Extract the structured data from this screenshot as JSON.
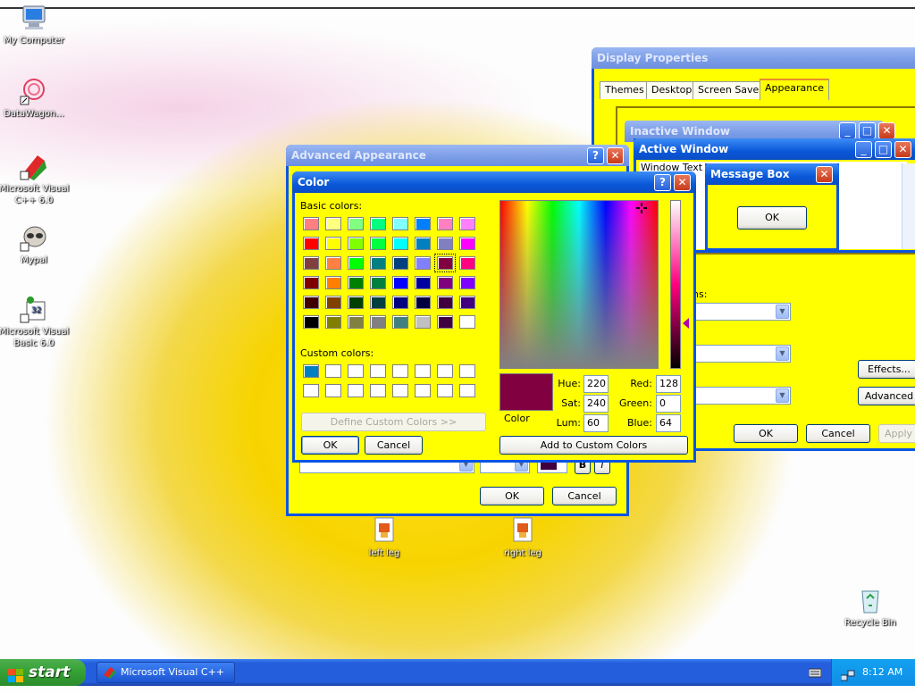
{
  "desktop_icons": [
    {
      "label": "My Computer",
      "icon": "computer-icon"
    },
    {
      "label": "DataWagon...",
      "icon": "datawagon-icon"
    },
    {
      "label": "Microsoft Visual C++ 6.0",
      "icon": "visual-cpp-icon"
    },
    {
      "label": "Mypal",
      "icon": "mypal-icon"
    },
    {
      "label": "Microsoft Visual Basic 6.0",
      "icon": "visual-basic-icon"
    },
    {
      "label": "left leg",
      "icon": "file-icon"
    },
    {
      "label": "right leg",
      "icon": "file-icon"
    },
    {
      "label": "Recycle Bin",
      "icon": "recycle-bin-icon"
    }
  ],
  "display_properties": {
    "title": "Display Properties",
    "tabs": [
      "Themes",
      "Desktop",
      "Screen Saver",
      "Appearance"
    ],
    "preview": {
      "inactive_title": "Inactive Window",
      "active_title": "Active Window",
      "window_text": "Window Text",
      "message_box_title": "Message Box",
      "message_box_ok": "OK"
    },
    "labels": {
      "partial_ns": "ns:"
    },
    "buttons": {
      "effects": "Effects...",
      "advanced": "Advanced",
      "ok": "OK",
      "cancel": "Cancel",
      "apply": "Apply"
    }
  },
  "advanced_appearance": {
    "title": "Advanced Appearance",
    "buttons": {
      "ok": "OK",
      "cancel": "Cancel"
    },
    "font_bold": "B",
    "font_italic": "I"
  },
  "color_dialog": {
    "title": "Color",
    "basic_colors_label": "Basic colors:",
    "custom_colors_label": "Custom colors:",
    "define_custom": "Define Custom Colors >>",
    "ok": "OK",
    "cancel": "Cancel",
    "add_to_custom": "Add to Custom Colors",
    "color_label": "Color",
    "hue_label": "Hue:",
    "sat_label": "Sat:",
    "lum_label": "Lum:",
    "red_label": "Red:",
    "green_label": "Green:",
    "blue_label": "Blue:",
    "hue": "220",
    "sat": "240",
    "lum": "60",
    "red": "128",
    "green": "0",
    "blue": "64",
    "selected_color": "#800040",
    "basic_colors": [
      [
        "#ff8080",
        "#ffff80",
        "#80ff80",
        "#00ff80",
        "#80ffff",
        "#0080ff",
        "#ff80c0",
        "#ff80ff"
      ],
      [
        "#ff0000",
        "#ffff00",
        "#80ff00",
        "#00ff40",
        "#00ffff",
        "#0080c0",
        "#8080c0",
        "#ff00ff"
      ],
      [
        "#804040",
        "#ff8040",
        "#00ff00",
        "#008080",
        "#004080",
        "#8080ff",
        "#800040",
        "#ff0080"
      ],
      [
        "#800000",
        "#ff8000",
        "#008000",
        "#008040",
        "#0000ff",
        "#0000a0",
        "#800080",
        "#8000ff"
      ],
      [
        "#400000",
        "#804000",
        "#004000",
        "#004040",
        "#000080",
        "#000040",
        "#400040",
        "#400080"
      ],
      [
        "#000000",
        "#808000",
        "#808040",
        "#808080",
        "#408080",
        "#c0c0c0",
        "#400040",
        "#ffffff"
      ]
    ],
    "custom_colors": [
      [
        "#0080c0",
        "#ffffff",
        "#ffffff",
        "#ffffff",
        "#ffffff",
        "#ffffff",
        "#ffffff",
        "#ffffff"
      ],
      [
        "#ffffff",
        "#ffffff",
        "#ffffff",
        "#ffffff",
        "#ffffff",
        "#ffffff",
        "#ffffff",
        "#ffffff"
      ]
    ]
  },
  "taskbar": {
    "start_label": "start",
    "task_item": "Microsoft Visual C++",
    "clock": "8:12 AM"
  },
  "colors": {
    "window_face": "#ffff00",
    "titlebar_blue": "#0a58d8",
    "taskbar_blue": "#245edc"
  }
}
